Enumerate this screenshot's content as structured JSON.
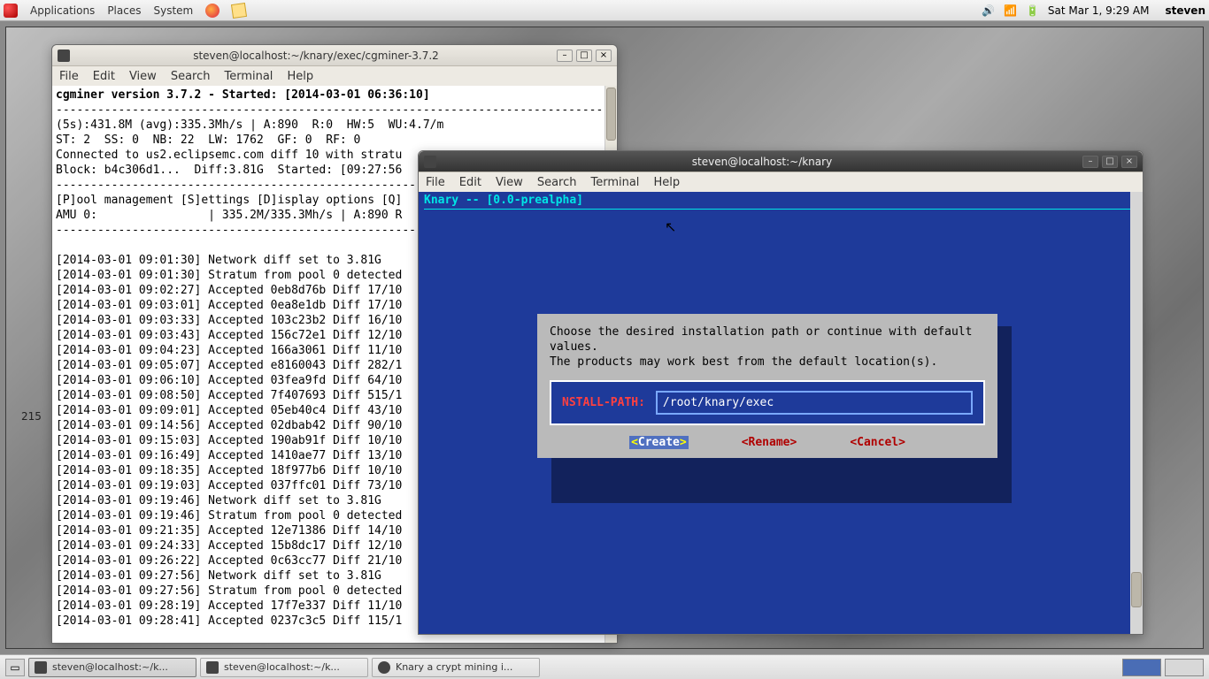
{
  "panel": {
    "menus": [
      "Applications",
      "Places",
      "System"
    ],
    "clock": "Sat Mar 1,  9:29 AM",
    "user": "steven"
  },
  "side_num": "215",
  "term1": {
    "title": "steven@localhost:~/knary/exec/cgminer-3.7.2",
    "menus": [
      "File",
      "Edit",
      "View",
      "Search",
      "Terminal",
      "Help"
    ],
    "header": "cgminer version 3.7.2 - Started: [2014-03-01 06:36:10]",
    "dash": "--------------------------------------------------------------------------------",
    "stats1": "(5s):431.8M (avg):335.3Mh/s | A:890  R:0  HW:5  WU:4.7/m",
    "stats2": "ST: 2  SS: 0  NB: 22  LW: 1762  GF: 0  RF: 0",
    "stats3": "Connected to us2.eclipsemc.com diff 10 with stratu",
    "stats4": "Block: b4c306d1...  Diff:3.81G  Started: [09:27:56",
    "opts": "[P]ool management [S]ettings [D]isplay options [Q]",
    "amu": "AMU 0:                | 335.2M/335.3Mh/s | A:890 R",
    "log": [
      "[2014-03-01 09:01:30] Network diff set to 3.81G",
      "[2014-03-01 09:01:30] Stratum from pool 0 detected",
      "[2014-03-01 09:02:27] Accepted 0eb8d76b Diff 17/10",
      "[2014-03-01 09:03:01] Accepted 0ea8e1db Diff 17/10",
      "[2014-03-01 09:03:33] Accepted 103c23b2 Diff 16/10",
      "[2014-03-01 09:03:43] Accepted 156c72e1 Diff 12/10",
      "[2014-03-01 09:04:23] Accepted 166a3061 Diff 11/10",
      "[2014-03-01 09:05:07] Accepted e8160043 Diff 282/1",
      "[2014-03-01 09:06:10] Accepted 03fea9fd Diff 64/10",
      "[2014-03-01 09:08:50] Accepted 7f407693 Diff 515/1",
      "[2014-03-01 09:09:01] Accepted 05eb40c4 Diff 43/10",
      "[2014-03-01 09:14:56] Accepted 02dbab42 Diff 90/10",
      "[2014-03-01 09:15:03] Accepted 190ab91f Diff 10/10",
      "[2014-03-01 09:16:49] Accepted 1410ae77 Diff 13/10",
      "[2014-03-01 09:18:35] Accepted 18f977b6 Diff 10/10",
      "[2014-03-01 09:19:03] Accepted 037ffc01 Diff 73/10",
      "[2014-03-01 09:19:46] Network diff set to 3.81G",
      "[2014-03-01 09:19:46] Stratum from pool 0 detected",
      "[2014-03-01 09:21:35] Accepted 12e71386 Diff 14/10",
      "[2014-03-01 09:24:33] Accepted 15b8dc17 Diff 12/10",
      "[2014-03-01 09:26:22] Accepted 0c63cc77 Diff 21/10",
      "[2014-03-01 09:27:56] Network diff set to 3.81G",
      "[2014-03-01 09:27:56] Stratum from pool 0 detected",
      "[2014-03-01 09:28:19] Accepted 17f7e337 Diff 11/10",
      "[2014-03-01 09:28:41] Accepted 0237c3c5 Diff 115/1"
    ]
  },
  "term2": {
    "title": "steven@localhost:~/knary",
    "menus": [
      "File",
      "Edit",
      "View",
      "Search",
      "Terminal",
      "Help"
    ],
    "header": "Knary -- [0.0-prealpha]",
    "dialog": {
      "line1": "Choose the desired installation path or continue with default",
      "line2": "values.",
      "line3": "The products may work best from the default location(s).",
      "label": "NSTALL-PATH:",
      "value": "/root/knary/exec",
      "buttons": {
        "create": "Create",
        "rename": "Rename",
        "cancel": "Cancel"
      }
    }
  },
  "taskbar": {
    "items": [
      "steven@localhost:~/k...",
      "steven@localhost:~/k...",
      "Knary a crypt mining i..."
    ]
  }
}
